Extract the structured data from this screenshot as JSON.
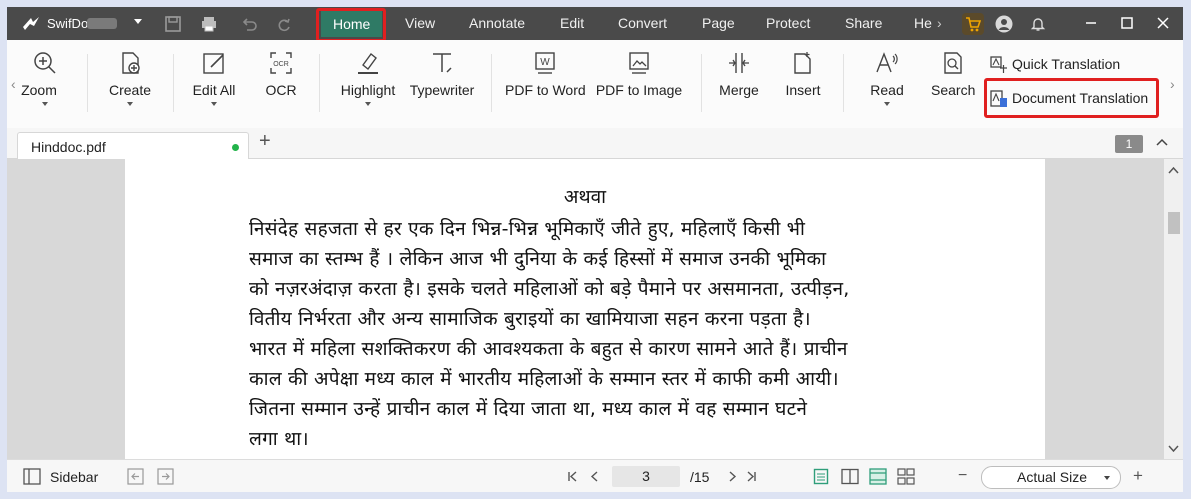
{
  "titlebar": {
    "app_name": "SwifDoo",
    "menus": [
      "Home",
      "View",
      "Annotate",
      "Edit",
      "Convert",
      "Page",
      "Protect",
      "Share",
      "He"
    ],
    "active_menu": "Home"
  },
  "ribbon": {
    "tools": {
      "zoom": "Zoom",
      "create": "Create",
      "edit_all": "Edit All",
      "ocr": "OCR",
      "ocr_icon_text": "OCR",
      "highlight": "Highlight",
      "typewriter": "Typewriter",
      "pdf_to_word": "PDF to Word",
      "pdf_to_word_icon_text": "W",
      "pdf_to_image": "PDF to Image",
      "merge": "Merge",
      "insert": "Insert",
      "read": "Read",
      "search": "Search"
    },
    "quick_translation": "Quick Translation",
    "document_translation": "Document Translation"
  },
  "tabs": {
    "current": "Hinddoc.pdf",
    "page_badge": "1"
  },
  "document": {
    "heading": "अथवा",
    "lines": [
      "निसंदेह सहजता से हर एक दिन भिन्न-भिन्न भूमिकाएँ जीते हुए, महिलाएँ किसी भी",
      "समाज का स्तम्भ हैं । लेकिन आज भी दुनिया के कई हिस्सों में समाज उनकी भूमिका",
      "को नज़रअंदाज़ करता है। इसके चलते महिलाओं को बड़े पैमाने पर असमानता, उत्पीड़न,",
      "वितीय निर्भरता और अन्य सामाजिक बुराइयों का खामियाजा सहन करना पड़ता है।",
      "भारत में महिला सशक्तिकरण की आवश्यकता के बहुत से कारण सामने आते हैं। प्राचीन",
      "काल की अपेक्षा मध्य काल में भारतीय महिलाओं के सम्मान स्तर में काफी कमी आयी।",
      "जितना सम्मान उन्हें प्राचीन काल में दिया जाता था, मध्य काल में वह सम्मान घटने",
      "लगा था।"
    ]
  },
  "statusbar": {
    "sidebar_label": "Sidebar",
    "current_page": "3",
    "total_pages": "/15",
    "zoom_label": "Actual Size",
    "zoom_minus": "−",
    "zoom_plus": "+"
  },
  "colors": {
    "titlebar_bg": "#4a4a4a",
    "active_menu_bg": "#2f7a65",
    "highlight_box": "#e02020",
    "unsaved_dot": "#22b34a",
    "cart_icon": "#f0a400"
  }
}
